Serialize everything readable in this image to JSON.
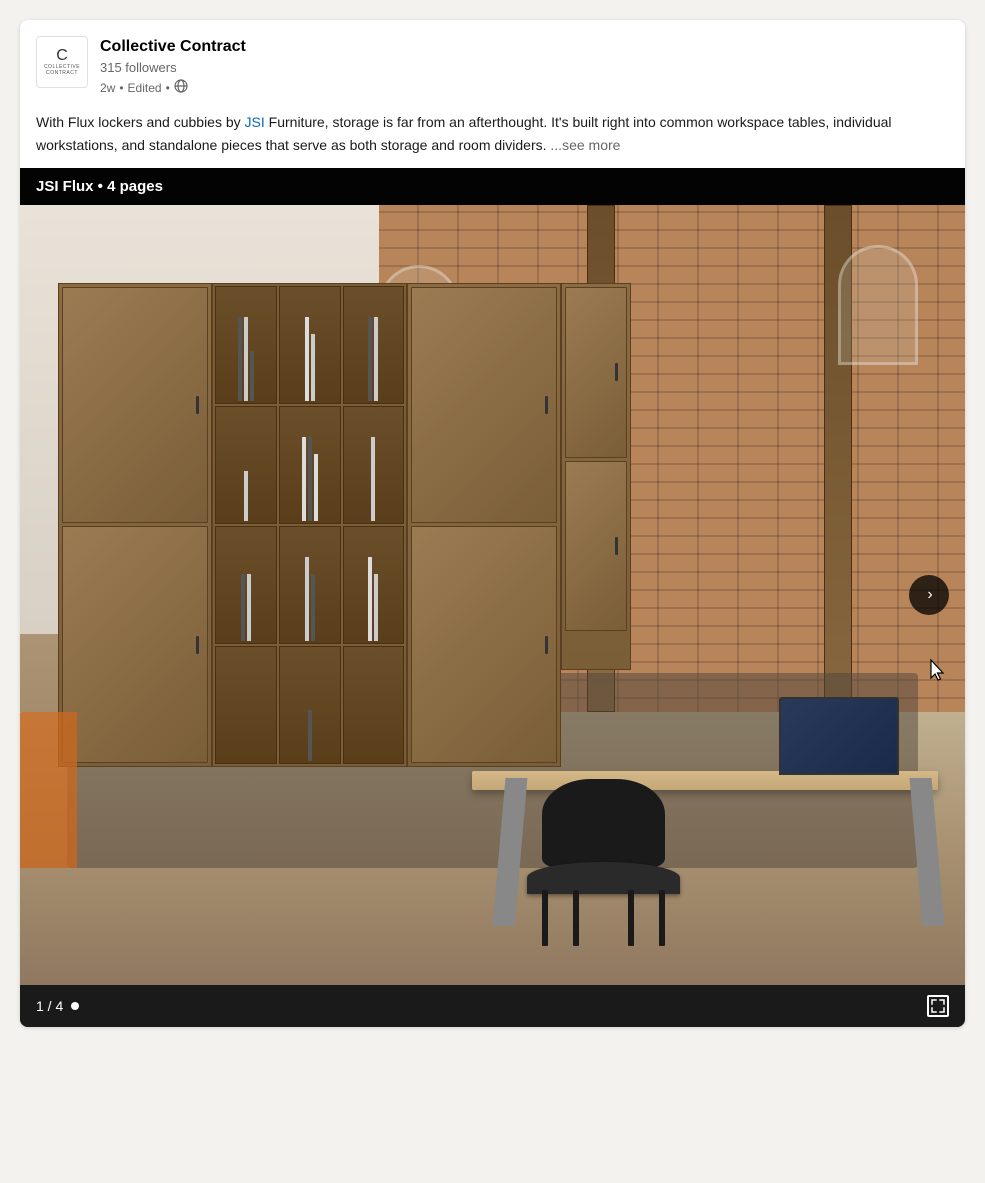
{
  "card": {
    "company": {
      "name": "Collective Contract",
      "followers": "315 followers",
      "logo_letter": "C",
      "logo_subtext": "COLLECTIVE\nCONTRACT"
    },
    "post_meta": {
      "time": "2w",
      "separator": "•",
      "edited": "Edited",
      "separator2": "•"
    },
    "post_text": {
      "before_link": "With Flux lockers and cubbies by ",
      "link_text": "JSI",
      "after_link": " Furniture, storage is far from an afterthought.\nIt's built right into common workspace tables, individual workstations, and\nstandalone pieces that serve as both storage and room dividers.",
      "see_more": "...see more"
    },
    "document": {
      "title": "JSI Flux • 4 pages",
      "page_current": "1",
      "page_total": "4",
      "page_label": "1 / 4"
    },
    "next_button_label": "›",
    "fullscreen_label": "⛶"
  }
}
